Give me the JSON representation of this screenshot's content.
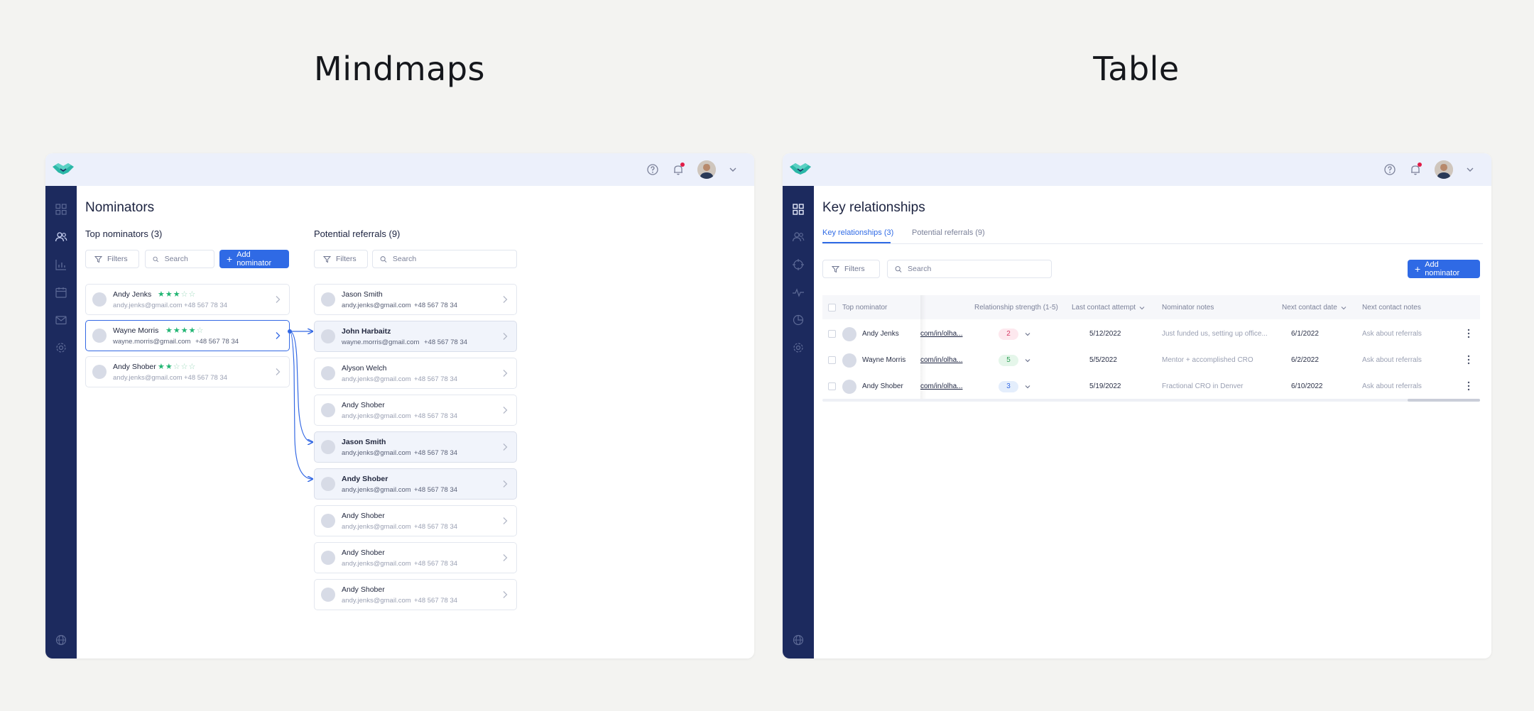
{
  "sections": {
    "left_title": "Mindmaps",
    "right_title": "Table"
  },
  "colors": {
    "accent": "#2f6ae5",
    "sidebar": "#1c2a5e",
    "topbar": "#ecf0fb",
    "stars": "#22b573",
    "notification": "#e11d48"
  },
  "mindmap": {
    "page_title": "Nominators",
    "top_nominators": {
      "title": "Top nominators (3)",
      "filters_label": "Filters",
      "search_placeholder": "Search",
      "add_label": "Add nominator",
      "items": [
        {
          "name": "Andy Jenks",
          "email": "andy.jenks@gmail.com",
          "phone": "+48 567 78 34",
          "rating": 3
        },
        {
          "name": "Wayne Morris",
          "email": "wayne.morris@gmail.com",
          "phone": "+48 567 78 34",
          "rating": 4
        },
        {
          "name": "Andy Shober",
          "email": "andy.jenks@gmail.com",
          "phone": "+48 567 78 34",
          "rating": 2
        }
      ]
    },
    "potential_referrals": {
      "title": "Potential referrals (9)",
      "filters_label": "Filters",
      "search_placeholder": "Search",
      "items": [
        {
          "name": "Jason Smith",
          "email": "andy.jenks@gmail.com",
          "phone": "+48 567 78 34"
        },
        {
          "name": "John Harbaitz",
          "email": "wayne.morris@gmail.com",
          "phone": "+48 567 78 34"
        },
        {
          "name": "Alyson Welch",
          "email": "andy.jenks@gmail.com",
          "phone": "+48 567 78 34"
        },
        {
          "name": "Andy Shober",
          "email": "andy.jenks@gmail.com",
          "phone": "+48 567 78 34"
        },
        {
          "name": "Jason Smith",
          "email": "andy.jenks@gmail.com",
          "phone": "+48 567 78 34"
        },
        {
          "name": "Andy Shober",
          "email": "andy.jenks@gmail.com",
          "phone": "+48 567 78 34"
        },
        {
          "name": "Andy Shober",
          "email": "andy.jenks@gmail.com",
          "phone": "+48 567 78 34"
        },
        {
          "name": "Andy Shober",
          "email": "andy.jenks@gmail.com",
          "phone": "+48 567 78 34"
        },
        {
          "name": "Andy Shober",
          "email": "andy.jenks@gmail.com",
          "phone": "+48 567 78 34"
        }
      ]
    }
  },
  "table": {
    "page_title": "Key relationships",
    "tabs": [
      {
        "label": "Key relationships (3)",
        "active": true
      },
      {
        "label": "Potential referrals (9)",
        "active": false
      }
    ],
    "filters_label": "Filters",
    "search_placeholder": "Search",
    "add_label": "Add nominator",
    "columns": {
      "top_nominator": "Top nominator",
      "relationship_strength": "Relationship strength (1-5)",
      "last_contact_attempt": "Last contact attempt",
      "nominator_notes": "Nominator notes",
      "next_contact_date": "Next contact date",
      "next_contact_notes": "Next contact notes"
    },
    "rows": [
      {
        "name": "Andy Jenks",
        "linkedin": "com/in/olha...",
        "strength": "2",
        "last_contact": "5/12/2022",
        "notes": "Just funded us, setting up office...",
        "next_date": "6/1/2022",
        "next_notes": "Ask about referrals"
      },
      {
        "name": "Wayne Morris",
        "linkedin": "com/in/olha...",
        "strength": "5",
        "last_contact": "5/5/2022",
        "notes": "Mentor + accomplished CRO",
        "next_date": "6/2/2022",
        "next_notes": "Ask about referrals"
      },
      {
        "name": "Andy Shober",
        "linkedin": "com/in/olha...",
        "strength": "3",
        "last_contact": "5/19/2022",
        "notes": "Fractional CRO in Denver",
        "next_date": "6/10/2022",
        "next_notes": "Ask about referrals"
      }
    ],
    "strength_colors": [
      {
        "bg": "#fde8ee",
        "fg": "#d63864"
      },
      {
        "bg": "#e5f6ea",
        "fg": "#2e9e55"
      },
      {
        "bg": "#e4eefc",
        "fg": "#3469e4"
      }
    ]
  }
}
